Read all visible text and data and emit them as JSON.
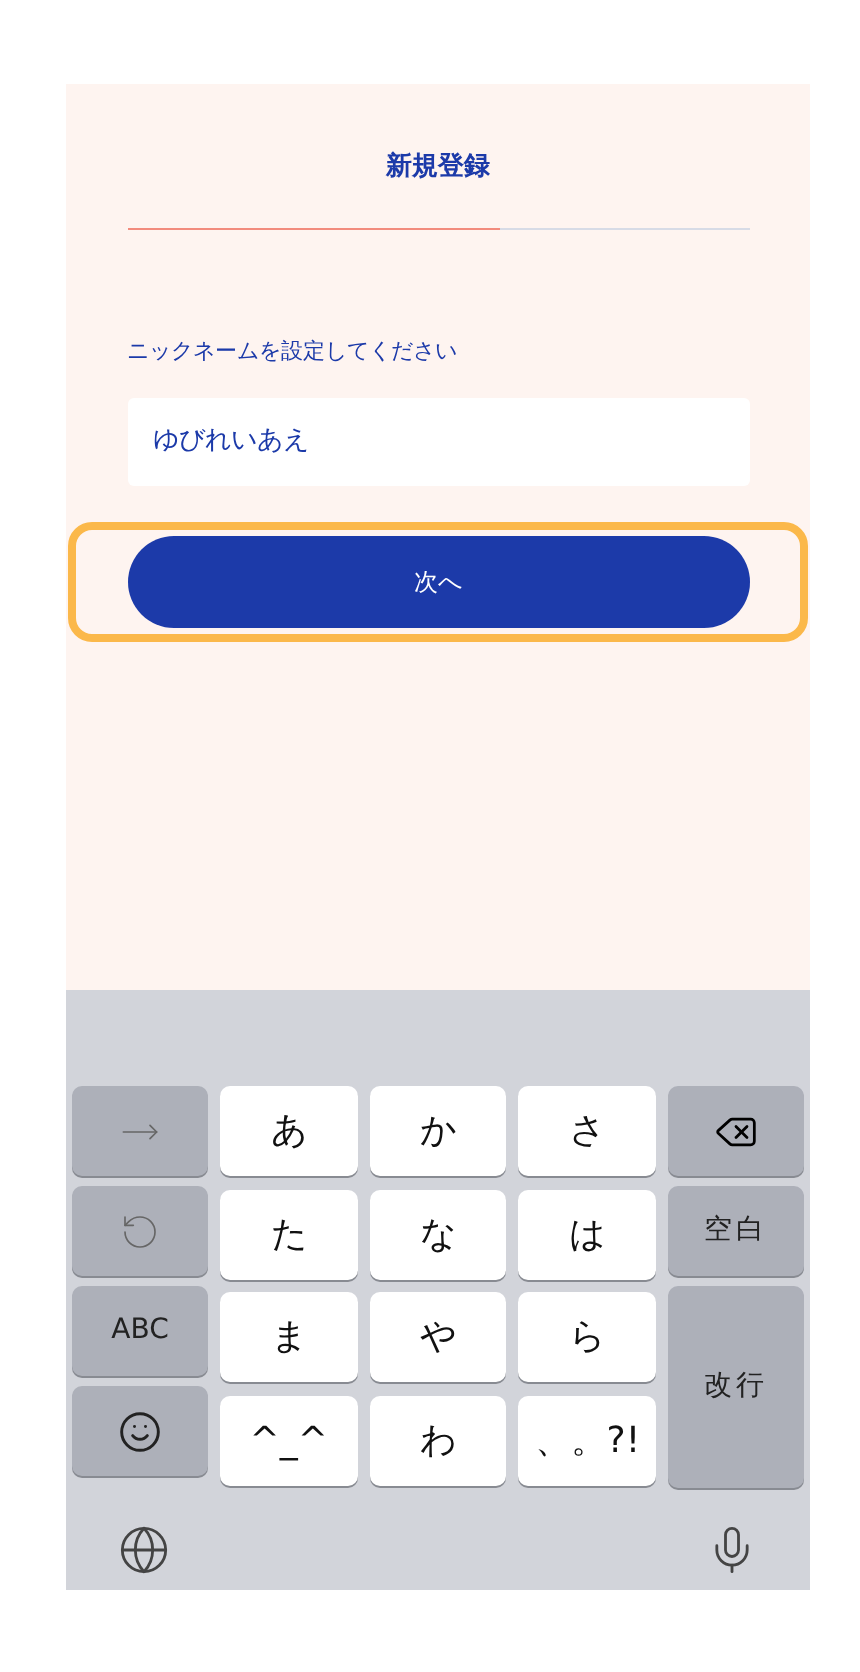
{
  "header": {
    "title": "新規登録"
  },
  "progress": {
    "level": 0.6
  },
  "nickname": {
    "label": "ニックネームを設定してください",
    "value": "ゆびれいあえ"
  },
  "next_button": {
    "label": "次へ",
    "highlighted": true
  },
  "keyboard": {
    "left_keys": [
      {
        "kind": "arrow"
      },
      {
        "kind": "undo"
      },
      {
        "kind": "text",
        "label": "ABC"
      },
      {
        "kind": "emoji"
      }
    ],
    "kana_keys": [
      {
        "label": "あ"
      },
      {
        "label": "か"
      },
      {
        "label": "さ"
      },
      {
        "label": "た"
      },
      {
        "label": "な"
      },
      {
        "label": "は"
      },
      {
        "label": "ま"
      },
      {
        "label": "や"
      },
      {
        "label": "ら"
      },
      {
        "label": "^_^"
      },
      {
        "label": "わ"
      },
      {
        "label": "、。?!"
      }
    ],
    "right_keys": [
      {
        "kind": "delete"
      },
      {
        "kind": "text",
        "label": "空白"
      },
      {
        "kind": "text",
        "label": "改行"
      }
    ]
  }
}
